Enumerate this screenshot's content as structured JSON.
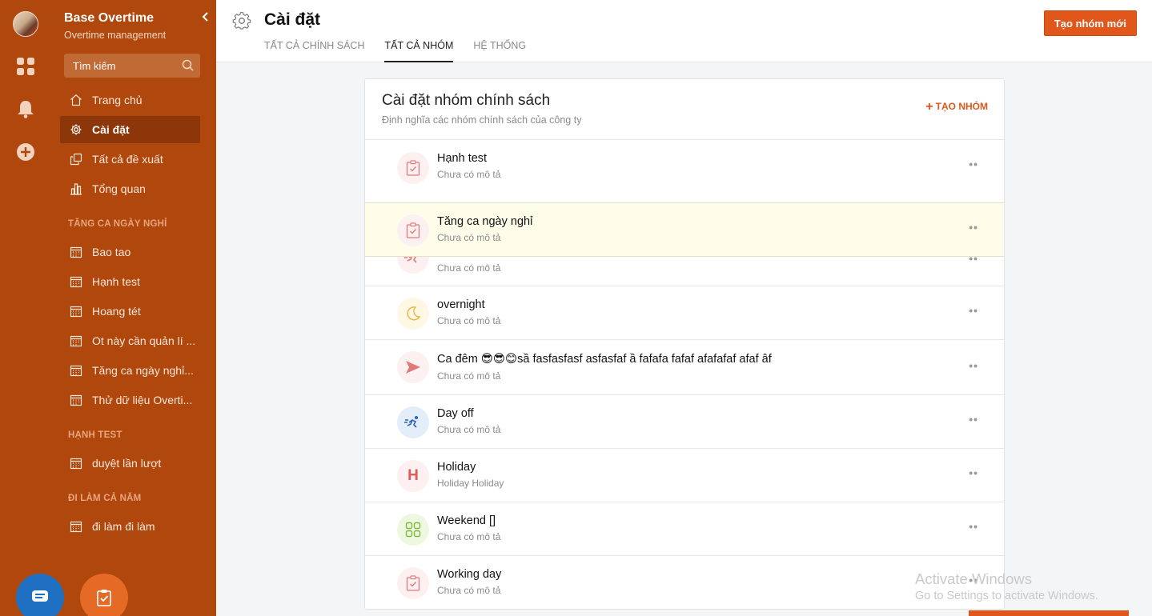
{
  "sidebar": {
    "app_title": "Base Overtime",
    "app_subtitle": "Overtime management",
    "search_placeholder": "Tìm kiếm",
    "main_items": [
      {
        "label": "Trang chủ",
        "icon": "home-icon"
      },
      {
        "label": "Cài đặt",
        "icon": "gear-icon"
      },
      {
        "label": "Tất cả đề xuất",
        "icon": "copy-icon"
      },
      {
        "label": "Tổng quan",
        "icon": "bar-chart-icon"
      }
    ],
    "sections": [
      {
        "title": "TĂNG CA NGÀY NGHỈ",
        "items": [
          "Bao tao",
          "Hạnh test",
          "Hoang tét",
          "Ot này cần quản lí ...",
          "Tăng ca ngày nghỉ...",
          "Thử dữ liệu Overti..."
        ]
      },
      {
        "title": "HẠNH TEST",
        "items": [
          "duyệt lần lượt"
        ]
      },
      {
        "title": "ĐI LÀM CẢ NĂM",
        "items": [
          "đi làm đi làm"
        ]
      }
    ]
  },
  "header": {
    "title": "Cài đặt",
    "tabs": [
      "TẤT CẢ CHÍNH SÁCH",
      "TẤT CẢ NHÓM",
      "HỆ THỐNG"
    ],
    "active_tab": "TẤT CẢ NHÓM",
    "create_button": "Tạo nhóm mới"
  },
  "card": {
    "title": "Cài đặt nhóm chính sách",
    "subtitle": "Định nghĩa các nhóm chính sách của công ty",
    "add_label": "TẠO NHÓM",
    "rows": [
      {
        "name": "Hạnh test",
        "desc": "Chưa có mô tả",
        "icon": "clipboard-check-icon"
      },
      {
        "name": "Tăng ca ngày nghỉ",
        "desc": "Chưa có mô tả",
        "icon": "clipboard-check-icon"
      },
      {
        "name": "",
        "desc": "Chưa có mô tả",
        "icon": "running-icon"
      },
      {
        "name": "overnight",
        "desc": "Chưa có mô tả",
        "icon": "moon-icon"
      },
      {
        "name": "Ca đêm 😎😎😊sầ fasfasfasf asfasfaf ầ fafafa fafaf afafafaf afaf âf",
        "desc": "Chưa có mô tả",
        "icon": "send-icon"
      },
      {
        "name": "Day off",
        "desc": "Chưa có mô tả",
        "icon": "running-icon"
      },
      {
        "name": "Holiday",
        "desc": "Holiday Holiday",
        "icon": "letter-h-icon"
      },
      {
        "name": "Weekend []",
        "desc": "Chưa có mô tả",
        "icon": "grid-icon"
      },
      {
        "name": "Working day",
        "desc": "Chưa có mô tả",
        "icon": "clipboard-check-icon"
      }
    ],
    "more_label": "••"
  },
  "watermark": {
    "line1": "Activate Windows",
    "line2": "Go to Settings to activate Windows."
  },
  "colors": {
    "sidebar": "#b0470c",
    "accent": "#e0561b"
  }
}
